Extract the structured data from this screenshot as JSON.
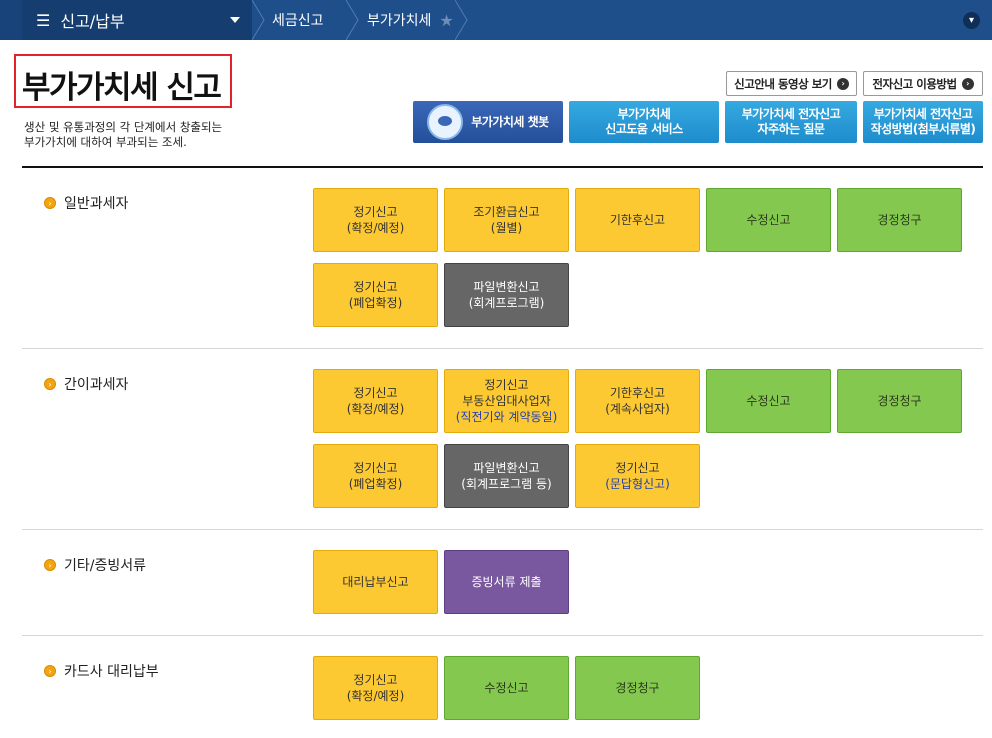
{
  "nav": {
    "menu_label": "신고/납부",
    "crumbs": [
      "세금신고",
      "부가가치세"
    ]
  },
  "header": {
    "title": "부가가치세 신고",
    "description": "생산 및 유통과정의 각 단계에서 창출되는\n부가가치에 대하여 부과되는 조세."
  },
  "links": {
    "video_guide": "신고안내 동영상 보기",
    "efile_howto": "전자신고 이용방법"
  },
  "services": {
    "chatbot": "부가가치세 챗봇",
    "help_service": "부가가치세\n신고도움 서비스",
    "faq": "부가가치세 전자신고\n자주하는 질문",
    "howto_docs": "부가가치세 전자신고\n작성방법(첨부서류별)"
  },
  "colors": {
    "nav_bg": "#1f4f8a",
    "yellow_tile": "#fcc933",
    "green_tile": "#84c850",
    "dark_tile": "#666666",
    "purple_tile": "#7a58a0",
    "title_highlight_border": "#e2242a"
  },
  "sections": [
    {
      "label": "일반과세자",
      "tiles": [
        {
          "text": "정기신고\n(확정/예정)",
          "color": "yellow"
        },
        {
          "text": "조기환급신고\n(월별)",
          "color": "yellow"
        },
        {
          "text": "기한후신고",
          "color": "yellow"
        },
        {
          "text": "수정신고",
          "color": "green"
        },
        {
          "text": "경정청구",
          "color": "green"
        },
        {
          "text": "정기신고\n(폐업확정)",
          "color": "yellow"
        },
        {
          "text": "파일변환신고\n(회계프로그램)",
          "color": "dark"
        }
      ]
    },
    {
      "label": "간이과세자",
      "tiles": [
        {
          "text": "정기신고\n(확정/예정)",
          "color": "yellow"
        },
        {
          "text": "정기신고\n부동산임대사업자",
          "highlight": "(직전기와 계약동일)",
          "color": "yellow"
        },
        {
          "text": "기한후신고\n(계속사업자)",
          "color": "yellow"
        },
        {
          "text": "수정신고",
          "color": "green"
        },
        {
          "text": "경정청구",
          "color": "green"
        },
        {
          "text": "정기신고\n(폐업확정)",
          "color": "yellow"
        },
        {
          "text": "파일변환신고\n(회계프로그램 등)",
          "color": "dark"
        },
        {
          "text": "정기신고",
          "highlight": "(문답형신고)",
          "color": "yellow"
        }
      ]
    },
    {
      "label": "기타/증빙서류",
      "tiles": [
        {
          "text": "대리납부신고",
          "color": "yellow"
        },
        {
          "text": "증빙서류 제출",
          "color": "purple"
        }
      ]
    },
    {
      "label": "카드사 대리납부",
      "tiles": [
        {
          "text": "정기신고\n(확정/예정)",
          "color": "yellow"
        },
        {
          "text": "수정신고",
          "color": "green"
        },
        {
          "text": "경정청구",
          "color": "green"
        }
      ]
    }
  ]
}
